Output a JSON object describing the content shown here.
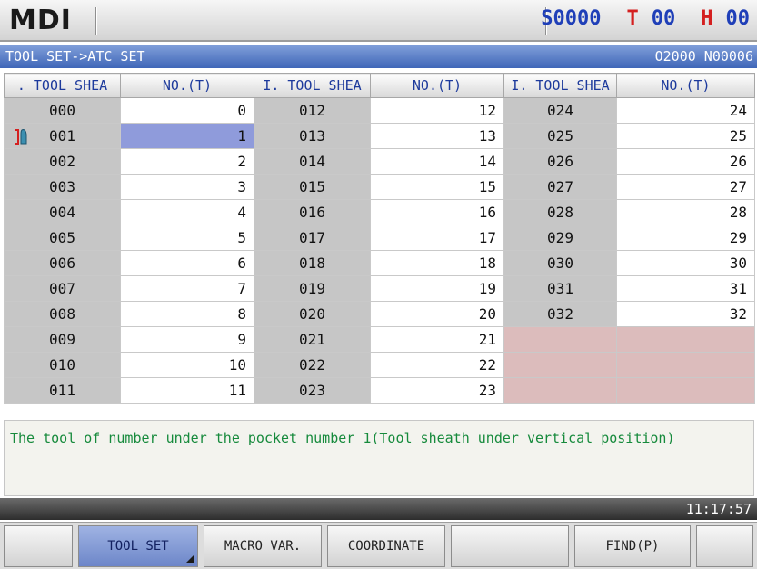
{
  "header": {
    "mode": "MDI",
    "spindle": "S0000",
    "tool": "T00",
    "offset": "H00",
    "colors": {
      "spindle": "#1f3fb8",
      "tool_prefix": "#d42020",
      "tool_digits": "#1f3fb8"
    }
  },
  "path_bar": {
    "left": "TOOL SET->ATC SET",
    "right": "O2000 N00006"
  },
  "table": {
    "headers": [
      ". TOOL SHEA",
      "NO.(T)",
      "I. TOOL SHEA",
      "NO.(T)",
      "I. TOOL SHEA",
      "NO.(T)"
    ],
    "selected_tool_icon": "tool-sheath-icon",
    "rows": [
      [
        [
          "000",
          "0"
        ],
        [
          "012",
          "12"
        ],
        [
          "024",
          "24"
        ]
      ],
      [
        [
          "001",
          "1"
        ],
        [
          "013",
          "13"
        ],
        [
          "025",
          "25"
        ]
      ],
      [
        [
          "002",
          "2"
        ],
        [
          "014",
          "14"
        ],
        [
          "026",
          "26"
        ]
      ],
      [
        [
          "003",
          "3"
        ],
        [
          "015",
          "15"
        ],
        [
          "027",
          "27"
        ]
      ],
      [
        [
          "004",
          "4"
        ],
        [
          "016",
          "16"
        ],
        [
          "028",
          "28"
        ]
      ],
      [
        [
          "005",
          "5"
        ],
        [
          "017",
          "17"
        ],
        [
          "029",
          "29"
        ]
      ],
      [
        [
          "006",
          "6"
        ],
        [
          "018",
          "18"
        ],
        [
          "030",
          "30"
        ]
      ],
      [
        [
          "007",
          "7"
        ],
        [
          "019",
          "19"
        ],
        [
          "031",
          "31"
        ]
      ],
      [
        [
          "008",
          "8"
        ],
        [
          "020",
          "20"
        ],
        [
          "032",
          "32"
        ]
      ],
      [
        [
          "009",
          "9"
        ],
        [
          "021",
          "21"
        ],
        [
          "",
          ""
        ]
      ],
      [
        [
          "010",
          "10"
        ],
        [
          "022",
          "22"
        ],
        [
          "",
          ""
        ]
      ],
      [
        [
          "011",
          "11"
        ],
        [
          "023",
          "23"
        ],
        [
          "",
          ""
        ]
      ]
    ]
  },
  "message": "The tool of number under the pocket number 1(Tool sheath under vertical position)",
  "clock": "11:17:57",
  "softkeys": [
    {
      "label": "",
      "active": false
    },
    {
      "label": "TOOL SET",
      "active": true
    },
    {
      "label": "MACRO VAR.",
      "active": false
    },
    {
      "label": "COORDINATE",
      "active": false
    },
    {
      "label": "",
      "active": false
    },
    {
      "label": "FIND(P)",
      "active": false
    },
    {
      "label": "",
      "active": false
    }
  ]
}
